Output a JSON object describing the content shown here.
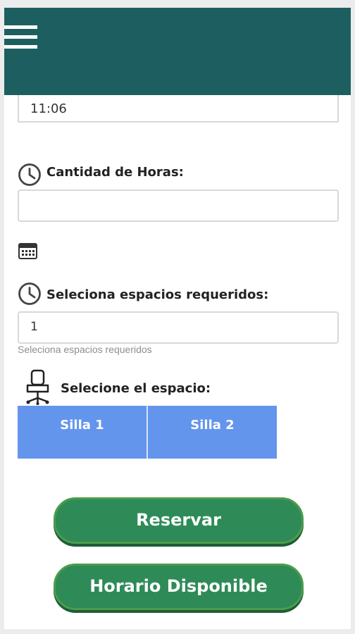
{
  "header": {
    "background_color": "#1d5f60",
    "menu_icon": "hamburger-menu-icon"
  },
  "form": {
    "time_value": "11:06",
    "hours_label": "Cantidad de Horas:",
    "hours_value": "",
    "spaces_label": "Seleciona espacios requeridos:",
    "spaces_value": "1",
    "spaces_helper": "Seleciona espacios requeridos",
    "select_space_label": "Selecione el espacio:"
  },
  "icons": {
    "hours": "clock-icon",
    "calendar": "calendar-icon",
    "spaces": "clock-icon",
    "space": "chair-icon"
  },
  "spaces": [
    {
      "label": "Silla 1"
    },
    {
      "label": "Silla 2"
    }
  ],
  "actions": {
    "reserve_label": "Reservar",
    "availability_label": "Horario Disponible"
  },
  "colors": {
    "seat_blue": "#6495ed",
    "button_green": "#2e8b57",
    "header_teal": "#1d5f60"
  }
}
